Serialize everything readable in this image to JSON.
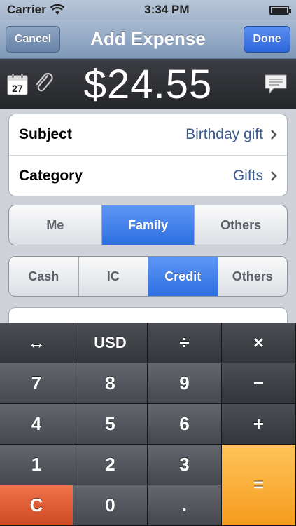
{
  "status_bar": {
    "carrier": "Carrier",
    "time": "3:34 PM"
  },
  "nav": {
    "cancel": "Cancel",
    "title": "Add Expense",
    "done": "Done"
  },
  "amount": {
    "value": "$24.55",
    "calendar_day": "27"
  },
  "form": {
    "subject": {
      "label": "Subject",
      "value": "Birthday gift"
    },
    "category": {
      "label": "Category",
      "value": "Gifts"
    }
  },
  "payer_segments": [
    {
      "label": "Me",
      "selected": false
    },
    {
      "label": "Family",
      "selected": true
    },
    {
      "label": "Others",
      "selected": false
    }
  ],
  "payment_segments": [
    {
      "label": "Cash",
      "selected": false
    },
    {
      "label": "IC",
      "selected": false
    },
    {
      "label": "Credit",
      "selected": true
    },
    {
      "label": "Others",
      "selected": false
    }
  ],
  "keypad": {
    "swap": "↔",
    "currency": "USD",
    "divide": "÷",
    "multiply": "×",
    "k7": "7",
    "k8": "8",
    "k9": "9",
    "minus": "−",
    "k4": "4",
    "k5": "5",
    "k6": "6",
    "plus": "+",
    "k1": "1",
    "k2": "2",
    "k3": "3",
    "clear": "C",
    "k0": "0",
    "dot": ".",
    "equals": "="
  },
  "icons": [
    "calendar-icon",
    "paperclip-icon",
    "note-icon",
    "wifi-icon",
    "battery-icon",
    "chevron-right-icon"
  ],
  "colors": {
    "accent": "#2d6fe0",
    "clear_key": "#cf4a22",
    "equals_key": "#f59b1c",
    "value_text": "#3b5a8d"
  }
}
